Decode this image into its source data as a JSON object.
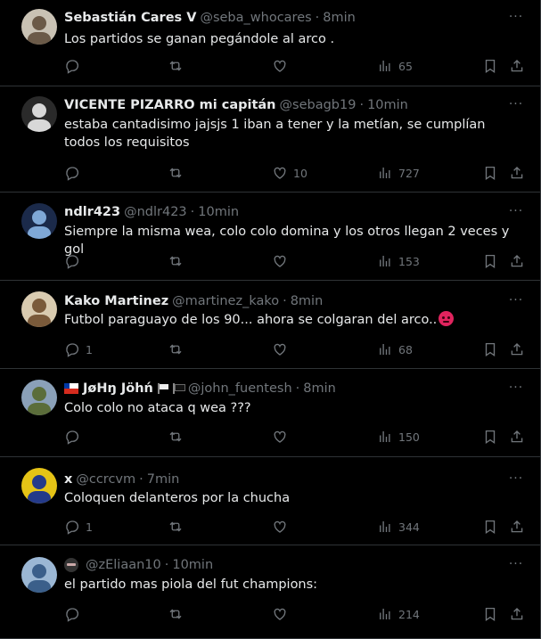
{
  "tweets": [
    {
      "name": "Sebastián Cares V",
      "handle": "@seba_whocares",
      "time": "8min",
      "text": "Los partidos se ganan pegándole al arco .",
      "replies": "",
      "likes": "",
      "views": "65",
      "avatar_colors": [
        "#c9c2b4",
        "#6b5a48"
      ]
    },
    {
      "name": "VICENTE PIZARRO mi capitán",
      "handle": "@sebagb19",
      "time": "10min",
      "text": "estaba cantadisimo jajsjs 1 iban a tener y la metían, se cumplían todos los requisitos",
      "replies": "",
      "likes": "10",
      "views": "727",
      "avatar_colors": [
        "#2a2a2a",
        "#d8d8d8"
      ]
    },
    {
      "name": "ndlr423",
      "handle": "@ndlr423",
      "time": "10min",
      "text": "Siempre la misma wea, colo colo domina y los otros llegan 2 veces y gol",
      "replies": "",
      "likes": "",
      "views": "153",
      "avatar_colors": [
        "#1b2a4a",
        "#7fa8d6"
      ]
    },
    {
      "name": "Kako Martinez",
      "handle": "@martinez_kako",
      "time": "8min",
      "text": "Futbol paraguayo de los 90... ahora se colgaran del arco..",
      "replies": "1",
      "likes": "",
      "views": "68",
      "avatar_colors": [
        "#d9cbb0",
        "#7a5a3a"
      ]
    },
    {
      "name": "JøHŋ Jöhń",
      "handle": "@john_fuentesh",
      "time": "8min",
      "text": "Colo colo no ataca q wea ???",
      "replies": "",
      "likes": "",
      "views": "150",
      "avatar_colors": [
        "#8aa0b8",
        "#5b6d3a"
      ]
    },
    {
      "name": "x",
      "handle": "@ccrcvm",
      "time": "7min",
      "text": "Coloquen delanteros por la chucha",
      "replies": "1",
      "likes": "",
      "views": "344",
      "avatar_colors": [
        "#e5c316",
        "#243a8a"
      ]
    },
    {
      "name": "",
      "handle": "@zEliaan10",
      "time": "10min",
      "text": "el partido mas piola del fut champions:",
      "replies": "",
      "likes": "",
      "views": "214",
      "avatar_colors": [
        "#9bb7d4",
        "#3b5f8a"
      ]
    }
  ],
  "more_label": "···",
  "icons": [
    "reply-icon",
    "retweet-icon",
    "like-icon",
    "views-icon",
    "bookmark-icon",
    "share-icon",
    "more-icon"
  ]
}
